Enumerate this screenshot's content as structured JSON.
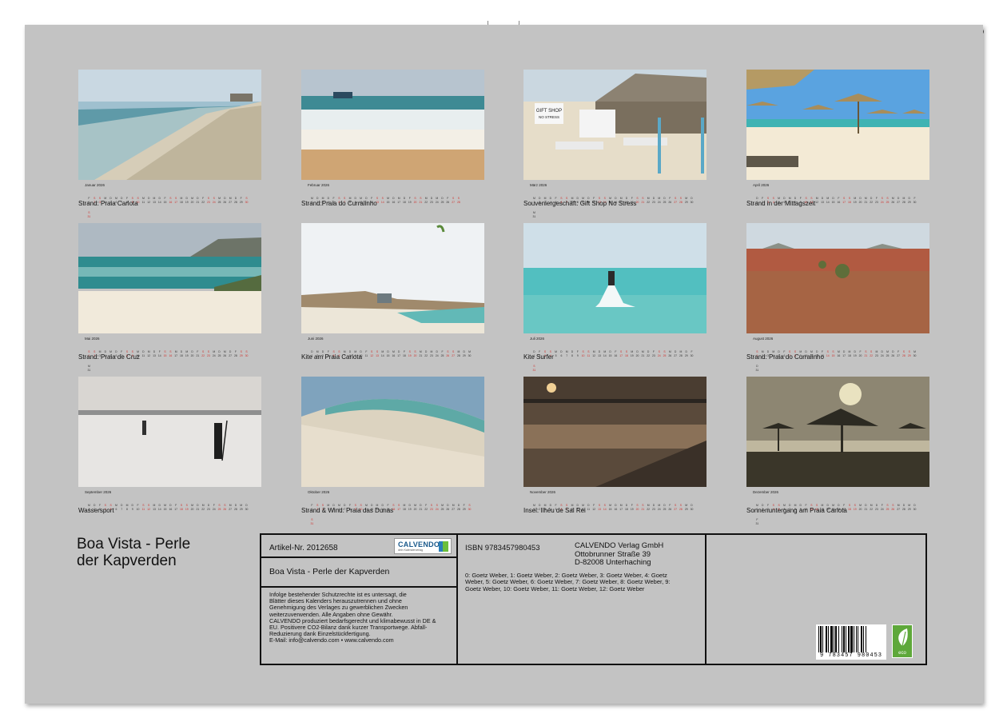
{
  "months": [
    {
      "month_label": "Januar 2026",
      "caption": "Strand: Praia Carlota"
    },
    {
      "month_label": "Februar 2026",
      "caption": "Strand:Praia do Curralinho"
    },
    {
      "month_label": "März 2026",
      "caption": "Souveniergeschäft: Gift Shop No Stress"
    },
    {
      "month_label": "April 2026",
      "caption": "Strand in der Mittagszeit"
    },
    {
      "month_label": "Mai 2026",
      "caption": "Strand: Praia de Cruz"
    },
    {
      "month_label": "Juni 2026",
      "caption": "Kite am Praia Carlota"
    },
    {
      "month_label": "Juli 2026",
      "caption": "Kite Surfer"
    },
    {
      "month_label": "August 2026",
      "caption": "Strand: Praia do Curralinho"
    },
    {
      "month_label": "September 2026",
      "caption": "Wassersport"
    },
    {
      "month_label": "Oktober 2026",
      "caption": "Strand & Wind: Praia das Dunas"
    },
    {
      "month_label": "November 2026",
      "caption": "Insel: Ilhéu de Sal Rei"
    },
    {
      "month_label": "Dezember 2026",
      "caption": "Sonnenuntergang am Praia Carlota"
    }
  ],
  "photo_text": {
    "gift_shop_sign_line1": "GIFT SHOP",
    "gift_shop_sign_line2": "NO STRESS"
  },
  "title": {
    "line1": "Boa Vista - Perle",
    "line2": "der Kapverden"
  },
  "info": {
    "article_no": "Artikel-Nr. 2012658",
    "logo_word": "CALVENDO",
    "logo_sub": "dein Kalenderverlag",
    "product_title": "Boa Vista - Perle der Kapverden",
    "legal_lines": [
      "Infolge bestehender Schutzrechte ist es untersagt, die",
      "Blätter dieses Kalenders herauszutrennen und ohne",
      "Genehmigung des Verlages zu gewerblichen Zwecken",
      "weiterzuverwenden. Alle Angaben ohne Gewähr.",
      "CALVENDO produziert bedarfsgerecht und klimabewusst in DE &",
      "EU. Positivere CO2-Bilanz dank kurzer Transportwege. Abfall-",
      "Reduzierung dank Einzelstückfertigung.",
      "E-Mail: info@calvendo.com • www.calvendo.com"
    ],
    "isbn": "ISBN 9783457980453",
    "publisher_lines": [
      "CALVENDO Verlag GmbH",
      "Ottobrunner Straße 39",
      "D-82008 Unterhaching"
    ],
    "credits_lines": [
      "0: Goetz Weber, 1: Goetz Weber, 2: Goetz Weber, 3: Goetz Weber, 4: Goetz",
      "Weber, 5: Goetz Weber, 6: Goetz Weber, 7: Goetz Weber, 8: Goetz Weber, 9:",
      "Goetz Weber, 10: Goetz Weber, 11: Goetz Weber, 12: Goetz Weber"
    ],
    "barcode_number": "9 783457 980453",
    "eco_label": "eco"
  },
  "colors": {
    "sheet_background": "#c3c3c3",
    "weekend_day": "#d0302c"
  }
}
